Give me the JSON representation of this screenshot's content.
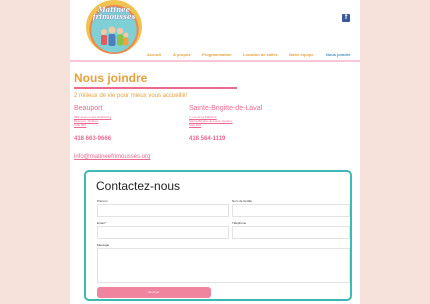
{
  "header": {
    "logo_text_line1": "Matinée",
    "logo_text_line2": "frimousses",
    "facebook_icon": "f"
  },
  "nav": [
    {
      "label": "Accueil",
      "active": false
    },
    {
      "label": "À propos",
      "active": false
    },
    {
      "label": "Programmation",
      "active": false
    },
    {
      "label": "Location de salles",
      "active": false
    },
    {
      "label": "Notre équipe",
      "active": false
    },
    {
      "label": "Nous joindre",
      "active": true
    }
  ],
  "main": {
    "title": "Nous joindre",
    "subtitle": "2 milieux de vie pour mieux vous accueillir!",
    "locations": [
      {
        "name": "Beauport",
        "address_lines": [
          "555, avenue des Hôtelleries",
          "Beauport, Québec",
          "G1E 6R1"
        ],
        "phone": "418 663-9666"
      },
      {
        "name": "Sainte-Brigitte-de-Laval",
        "address_lines": [
          "7, rue de la Patinoire",
          "Sainte-Brigitte-de-Laval, Québec",
          "G0A 3K0"
        ],
        "phone": "418 564-1119"
      }
    ],
    "email": "info@matineefrimousses.org"
  },
  "form": {
    "title": "Contactez-nous",
    "first_name_label": "Prénom",
    "last_name_label": "Nom de famille",
    "email_label": "Email *",
    "phone_label": "Téléphone",
    "message_label": "Message",
    "submit_label": "Envoyer"
  },
  "colors": {
    "background": "#f6e2da",
    "orange": "#e8a23b",
    "pink": "#ec6a8f",
    "teal": "#3fb9b6",
    "nav_active": "#3f8fbf"
  }
}
